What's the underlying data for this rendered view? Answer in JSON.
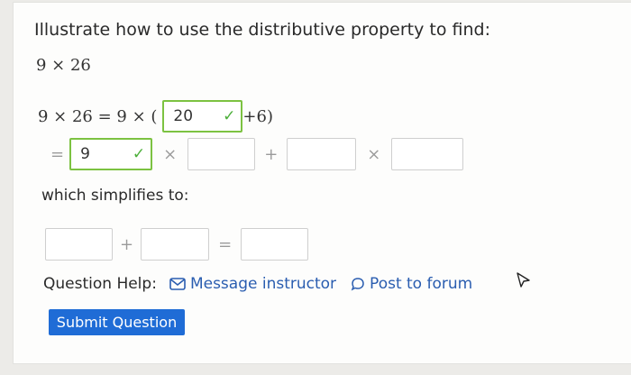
{
  "question": {
    "prompt": "Illustrate how to use the distributive property to find:",
    "expression": "9 × 26"
  },
  "step1": {
    "lhs": "9 × 26 = 9 × (",
    "box_value": "20",
    "after": "+6)"
  },
  "step2": {
    "equals": "=",
    "box1_value": "9",
    "times1": "×",
    "plus": "+",
    "times2": "×"
  },
  "simplify": {
    "label": "which simplifies to:",
    "plus": "+",
    "equals": "="
  },
  "help": {
    "label": "Question Help:",
    "message_label": "Message instructor",
    "forum_label": "Post to forum"
  },
  "submit_label": "Submit Question",
  "colors": {
    "correct_border": "#7cc241",
    "link": "#2a5db0",
    "button": "#1f6cd6"
  },
  "icons": [
    "check-icon",
    "mail-icon",
    "comment-icon",
    "cursor-icon"
  ]
}
